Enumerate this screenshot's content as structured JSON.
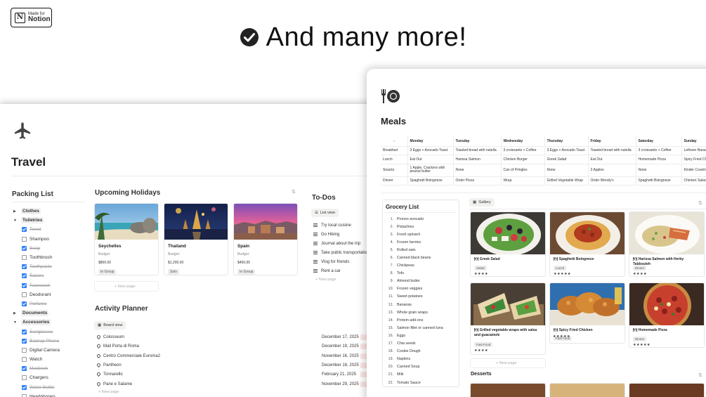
{
  "badge": {
    "line1": "Made for",
    "line2": "Notion",
    "logo": "N"
  },
  "headline": {
    "text": "And many more!",
    "icon": "check-circle-icon"
  },
  "travel": {
    "title": "Travel",
    "icon": "airplane-icon",
    "packing": {
      "title": "Packing List",
      "items": [
        {
          "label": "Clothes",
          "kind": "group",
          "open": false
        },
        {
          "label": "Toiletries",
          "kind": "group",
          "open": true
        },
        {
          "label": "Towel",
          "kind": "check",
          "checked": true
        },
        {
          "label": "Shampoo",
          "kind": "check",
          "checked": false
        },
        {
          "label": "Soap",
          "kind": "check",
          "checked": true
        },
        {
          "label": "Toothbrush",
          "kind": "check",
          "checked": false
        },
        {
          "label": "Toothpaste",
          "kind": "check",
          "checked": true
        },
        {
          "label": "Razors",
          "kind": "check",
          "checked": true
        },
        {
          "label": "Facewash",
          "kind": "check",
          "checked": true
        },
        {
          "label": "Deodorant",
          "kind": "check",
          "checked": false
        },
        {
          "label": "Perfume",
          "kind": "check",
          "checked": true
        },
        {
          "label": "Documents",
          "kind": "group",
          "open": false
        },
        {
          "label": "Accessories",
          "kind": "group",
          "open": true
        },
        {
          "label": "Sunglasses",
          "kind": "check",
          "checked": true
        },
        {
          "label": "Backup Phone",
          "kind": "check",
          "checked": true
        },
        {
          "label": "Digital Camera",
          "kind": "check",
          "checked": false
        },
        {
          "label": "Watch",
          "kind": "check",
          "checked": false
        },
        {
          "label": "Macbook",
          "kind": "check",
          "checked": true
        },
        {
          "label": "Chargers",
          "kind": "check",
          "checked": false
        },
        {
          "label": "Water Bottle",
          "kind": "check",
          "checked": true
        },
        {
          "label": "Headphones",
          "kind": "check",
          "checked": false
        }
      ]
    },
    "holidays": {
      "title": "Upcoming Holidays",
      "cards": [
        {
          "name": "Seychelles",
          "budget_label": "Budget:",
          "budget": "$800.00",
          "tag": "In Group"
        },
        {
          "name": "Thailand",
          "budget_label": "Budget:",
          "budget": "$1,200.00",
          "tag": "Solo"
        },
        {
          "name": "Spain",
          "budget_label": "Budget:",
          "budget": "$450.00",
          "tag": "In Group"
        }
      ],
      "new_page": "+ New page"
    },
    "todos": {
      "title": "To-Dos",
      "view_label": "List view",
      "items": [
        "Try local cuisine",
        "Go Hiking",
        "Journal about the trip",
        "Take public transportation",
        "Vlog for friends",
        "Rent a car"
      ],
      "new_page": "+ New page"
    },
    "activity": {
      "title": "Activity Planner",
      "view_label": "Board view",
      "rows": [
        {
          "place": "Colosseum",
          "date": "December 17, 2025"
        },
        {
          "place": "Mall Porta di Roma",
          "date": "December 19, 2025"
        },
        {
          "place": "Centro Commerciale Euroma2",
          "date": "November 16, 2025"
        },
        {
          "place": "Pantheon",
          "date": "December 18, 2025"
        },
        {
          "place": "Tonnarello",
          "date": "February 21, 2025"
        },
        {
          "place": "Pane e Salame",
          "date": "November 29, 2025"
        }
      ],
      "new_page": "+ New page"
    }
  },
  "meals": {
    "title": "Meals",
    "icon": "fork-plate-icon",
    "table": {
      "corner_icon": "sun-icon",
      "days": [
        "Monday",
        "Tuesday",
        "Wednesday",
        "Thursday",
        "Friday",
        "Saturday",
        "Sunday"
      ],
      "rows": [
        {
          "meal": "Breakfast",
          "cells": [
            "3 Eggs + Avocado Toast",
            "Toasted bread with nutella",
            "3 croissants + Coffee",
            "3 Eggs + Avocado Toast",
            "Toasted bread with nutella",
            "3 croissants + Coffee",
            "Leftover Banana Bread"
          ]
        },
        {
          "meal": "Lunch",
          "cells": [
            "Eat Out",
            "Harissa Salmon",
            "Chicken Burger",
            "Greek Salad",
            "Eat Out",
            "Homemade Pizza",
            "Spicy Fried Chicken"
          ]
        },
        {
          "meal": "Snacks",
          "cells": [
            "1 Apple, Crackers with peanut butter",
            "None",
            "Can of Pringles",
            "None",
            "2 Apples",
            "None",
            "Kinder Country"
          ]
        },
        {
          "meal": "Dinner",
          "cells": [
            "Spaghetti Bolognese",
            "Order Pizza",
            "Wrap",
            "Grilled Vegetable Wrap",
            "Order Wendy's",
            "Spaghetti Bolognese",
            "Chicken Salad"
          ]
        }
      ]
    },
    "grocery": {
      "title": "Grocery List",
      "items": [
        "Prunes avocado",
        "Pistachios",
        "Fresh spinach",
        "Frozen berries",
        "Rolled oats",
        "Canned black beans",
        "Chickpeas",
        "Tofu",
        "Almond butter",
        "Frozen veggies",
        "Sweet potatoes",
        "Bananas",
        "Whole grain wraps",
        "Protein add-ons",
        "Salmon fillet or canned tuna",
        "Eggs",
        "Chia seeds",
        "Cookie Dough",
        "Napkins",
        "Canned Soup",
        "Milk",
        "Tomato Sauce"
      ]
    },
    "gallery": {
      "view_label": "Gallery",
      "cards": [
        {
          "name": "Greek Salad",
          "tag": "Salad",
          "stars": "★★★★"
        },
        {
          "name": "Spaghetti Bolognese",
          "tag": "Lunch",
          "stars": "★★★★★"
        },
        {
          "name": "Harissa Salmon with Herby Tabbouleh",
          "tag": "Dinner",
          "stars": "★★★★"
        },
        {
          "name": "Grilled vegetable wraps with salsa and guacamole",
          "tag": "Fast Food",
          "stars": "★★★★"
        },
        {
          "name": "Spicy Fried Chicken",
          "tag": "Fast Food",
          "stars": "★★★★★"
        },
        {
          "name": "Homemade Pizza",
          "tag": "Dinner",
          "stars": "★★★★★"
        }
      ],
      "new_page": "+ New page"
    },
    "desserts": {
      "title": "Desserts"
    }
  }
}
